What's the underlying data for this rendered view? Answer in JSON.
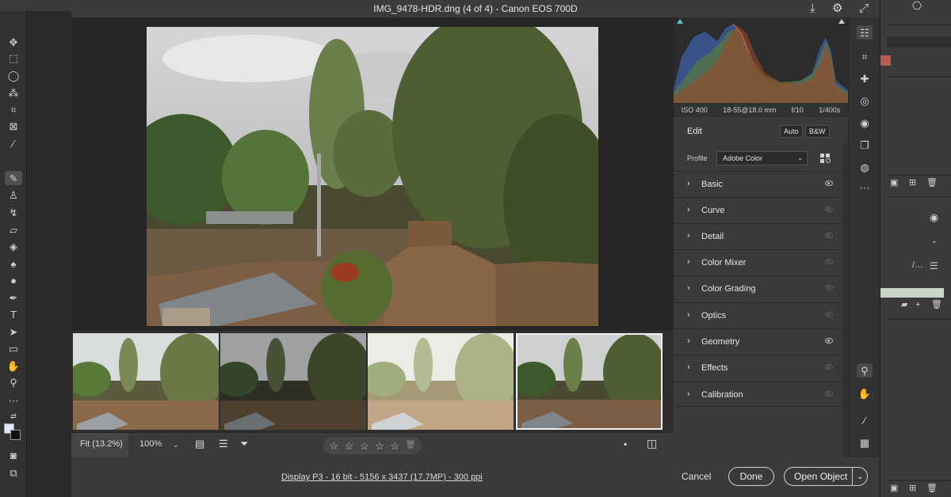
{
  "window": {
    "title": "IMG_9478-HDR.dng (4 of 4)  -  Canon EOS 700D"
  },
  "exif": {
    "iso": "ISO 400",
    "lens": "18-55@18.0 mm",
    "aperture": "f/10",
    "shutter": "1/400s"
  },
  "edit": {
    "title": "Edit",
    "auto_label": "Auto",
    "bw_label": "B&W",
    "profile_label": "Profile",
    "profile_value": "Adobe Color",
    "sections": [
      {
        "label": "Basic",
        "visible": true
      },
      {
        "label": "Curve",
        "visible": false
      },
      {
        "label": "Detail",
        "visible": false
      },
      {
        "label": "Color Mixer",
        "visible": false
      },
      {
        "label": "Color Grading",
        "visible": false
      },
      {
        "label": "Optics",
        "visible": false
      },
      {
        "label": "Geometry",
        "visible": true
      },
      {
        "label": "Effects",
        "visible": false
      },
      {
        "label": "Calibration",
        "visible": false
      }
    ]
  },
  "viewer": {
    "fit_label": "Fit (13.2%)",
    "zoom_label": "100%",
    "rating": 0
  },
  "footer": {
    "info_link": "Display P3 - 16 bit - 5156 x 3437 (17.7MP) - 300 ppi",
    "cancel_label": "Cancel",
    "done_label": "Done",
    "open_label": "Open Object"
  },
  "colors": {
    "accent": "#5ec8c8",
    "panel": "#3a3a3a",
    "canvas": "#262626"
  }
}
